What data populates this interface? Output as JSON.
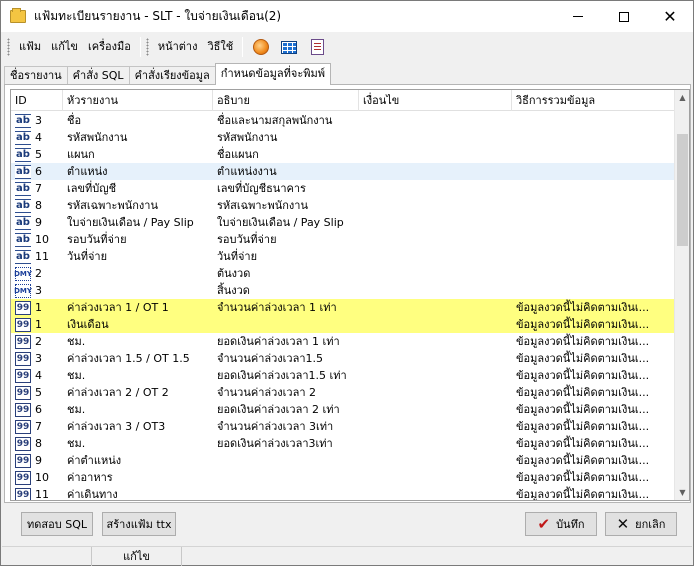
{
  "window": {
    "title": "แฟ้มทะเบียนรายงาน - SLT - ใบจ่ายเงินเดือน(2)"
  },
  "menu": {
    "items": [
      "แฟ้ม",
      "แก้ไข",
      "เครื่องมือ",
      "หน้าต่าง",
      "วิธีใช้"
    ]
  },
  "toolbar": {
    "icons": [
      "orange-circle-icon",
      "grid-icon",
      "report-icon"
    ]
  },
  "tabs": [
    {
      "label": "ชื่อรายงาน",
      "active": false
    },
    {
      "label": "คำสั่ง SQL",
      "active": false
    },
    {
      "label": "คำสั่งเรียงข้อมูล",
      "active": false
    },
    {
      "label": "กำหนดข้อมูลที่จะพิมพ์",
      "active": true
    }
  ],
  "grid": {
    "columns": [
      "ID",
      "หัวรายงาน",
      "อธิบาย",
      "เงื่อนไข",
      "วิธีการรวมข้อมูล"
    ],
    "rows": [
      {
        "type": "ab",
        "id": "3",
        "title": "ชื่อ",
        "desc": "ชื่อและนามสกุลพนักงาน",
        "cond": "",
        "agg": "",
        "hl": ""
      },
      {
        "type": "ab",
        "id": "4",
        "title": "รหัสพนักงาน",
        "desc": "รหัสพนักงาน",
        "cond": "",
        "agg": "",
        "hl": ""
      },
      {
        "type": "ab",
        "id": "5",
        "title": "แผนก",
        "desc": "ชื่อแผนก",
        "cond": "",
        "agg": "",
        "hl": ""
      },
      {
        "type": "ab",
        "id": "6",
        "title": "ตำแหน่ง",
        "desc": "ตำแหน่งงาน",
        "cond": "",
        "agg": "",
        "hl": "light"
      },
      {
        "type": "ab",
        "id": "7",
        "title": "เลขที่บัญชี",
        "desc": "เลขที่บัญชีธนาคาร",
        "cond": "",
        "agg": "",
        "hl": ""
      },
      {
        "type": "ab",
        "id": "8",
        "title": "รหัสเฉพาะพนักงาน",
        "desc": "รหัสเฉพาะพนักงาน",
        "cond": "",
        "agg": "",
        "hl": ""
      },
      {
        "type": "ab",
        "id": "9",
        "title": "ใบจ่ายเงินเดือน / Pay Slip",
        "desc": "ใบจ่ายเงินเดือน / Pay Slip",
        "cond": "",
        "agg": "",
        "hl": ""
      },
      {
        "type": "ab",
        "id": "10",
        "title": "รอบวันที่จ่าย",
        "desc": "รอบวันที่จ่าย",
        "cond": "",
        "agg": "",
        "hl": ""
      },
      {
        "type": "ab",
        "id": "11",
        "title": "วันที่จ่าย",
        "desc": "วันที่จ่าย",
        "cond": "",
        "agg": "",
        "hl": ""
      },
      {
        "type": "dmy",
        "id": "2",
        "title": "",
        "desc": "ต้นงวด",
        "cond": "",
        "agg": "",
        "hl": ""
      },
      {
        "type": "dmy",
        "id": "3",
        "title": "",
        "desc": "สิ้นงวด",
        "cond": "",
        "agg": "",
        "hl": ""
      },
      {
        "type": "num",
        "id": "1",
        "title": "ค่าล่วงเวลา 1 / OT 1",
        "desc": "จำนวนค่าล่วงเวลา 1 เท่า",
        "cond": "",
        "agg": "ข้อมูลงวดนี้ไม่คิดตามเงินเ...",
        "hl": "yellow"
      },
      {
        "type": "num",
        "id": "1",
        "title": "เงินเดือน",
        "desc": "",
        "cond": "",
        "agg": "ข้อมูลงวดนี้ไม่คิดตามเงินเ...",
        "hl": "yellow"
      },
      {
        "type": "num",
        "id": "2",
        "title": "ชม.",
        "desc": "ยอดเงินค่าล่วงเวลา 1 เท่า",
        "cond": "",
        "agg": "ข้อมูลงวดนี้ไม่คิดตามเงินเ...",
        "hl": ""
      },
      {
        "type": "num",
        "id": "3",
        "title": "ค่าล่วงเวลา 1.5 / OT 1.5",
        "desc": "จำนวนค่าล่วงเวลา1.5",
        "cond": "",
        "agg": "ข้อมูลงวดนี้ไม่คิดตามเงินเ...",
        "hl": ""
      },
      {
        "type": "num",
        "id": "4",
        "title": "ชม.",
        "desc": "ยอดเงินค่าล่วงเวลา1.5 เท่า",
        "cond": "",
        "agg": "ข้อมูลงวดนี้ไม่คิดตามเงินเ...",
        "hl": ""
      },
      {
        "type": "num",
        "id": "5",
        "title": "ค่าล่วงเวลา 2 / OT 2",
        "desc": "จำนวนค่าล่วงเวลา 2",
        "cond": "",
        "agg": "ข้อมูลงวดนี้ไม่คิดตามเงินเ...",
        "hl": ""
      },
      {
        "type": "num",
        "id": "6",
        "title": "ชม.",
        "desc": "ยอดเงินค่าล่วงเวลา 2 เท่า",
        "cond": "",
        "agg": "ข้อมูลงวดนี้ไม่คิดตามเงินเ...",
        "hl": ""
      },
      {
        "type": "num",
        "id": "7",
        "title": "ค่าล่วงเวลา 3 / OT3",
        "desc": "จำนวนค่าล่วงเวลา 3เท่า",
        "cond": "",
        "agg": "ข้อมูลงวดนี้ไม่คิดตามเงินเ...",
        "hl": ""
      },
      {
        "type": "num",
        "id": "8",
        "title": "ชม.",
        "desc": "ยอดเงินค่าล่วงเวลา3เท่า",
        "cond": "",
        "agg": "ข้อมูลงวดนี้ไม่คิดตามเงินเ...",
        "hl": ""
      },
      {
        "type": "num",
        "id": "9",
        "title": "ค่าตำแหน่ง",
        "desc": "",
        "cond": "",
        "agg": "ข้อมูลงวดนี้ไม่คิดตามเงินเ...",
        "hl": ""
      },
      {
        "type": "num",
        "id": "10",
        "title": "ค่าอาหาร",
        "desc": "",
        "cond": "",
        "agg": "ข้อมูลงวดนี้ไม่คิดตามเงินเ...",
        "hl": ""
      },
      {
        "type": "num",
        "id": "11",
        "title": "ค่าเดินทาง",
        "desc": "",
        "cond": "",
        "agg": "ข้อมูลงวดนี้ไม่คิดตามเงินเ...",
        "hl": ""
      }
    ]
  },
  "buttons": {
    "test_sql": "ทดสอบ SQL",
    "create_ttx": "สร้างแฟ้ม ttx",
    "save": "บันทึก",
    "cancel": "ยกเลิก"
  },
  "statusbar": {
    "mode": "แก้ไข"
  },
  "colors": {
    "highlight_yellow": "#ffff80",
    "highlight_light": "#e6f1fb"
  }
}
